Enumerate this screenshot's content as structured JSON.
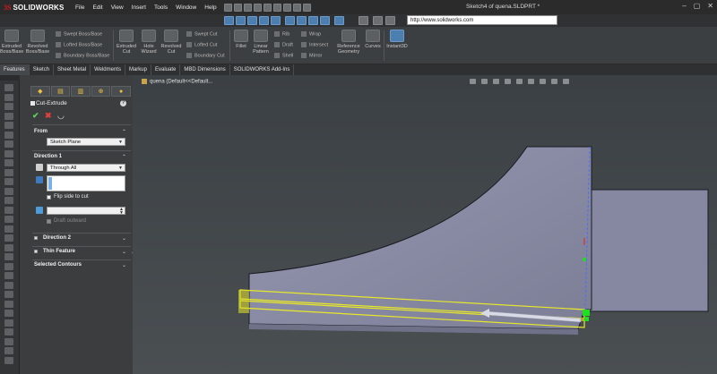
{
  "titlebar": {
    "brand": "SOLIDWORKS",
    "brand_prefix": "3S",
    "menus": [
      "File",
      "Edit",
      "View",
      "Insert",
      "Tools",
      "Window",
      "Help"
    ],
    "doc_title": "Sketch4 of quena.SLDPRT *",
    "window_controls": [
      "–",
      "▢",
      "✕"
    ]
  },
  "url_bar": {
    "value": "http://www.solidworks.com"
  },
  "ribbon": {
    "extruded_boss": "Extruded\nBoss/Base",
    "revolved_boss": "Revolved\nBoss/Base",
    "swept_boss": "Swept Boss/Base",
    "lofted_boss": "Lofted Boss/Base",
    "boundary_boss": "Boundary Boss/Base",
    "extruded_cut": "Extruded\nCut",
    "hole_wizard": "Hole\nWizard",
    "revolved_cut": "Revolved\nCut",
    "swept_cut": "Swept Cut",
    "lofted_cut": "Lofted Cut",
    "boundary_cut": "Boundary Cut",
    "fillet": "Fillet",
    "linear_pattern": "Linear\nPattern",
    "rib": "Rib",
    "draft": "Draft",
    "shell": "Shell",
    "wrap": "Wrap",
    "intersect": "Intersect",
    "mirror": "Mirror",
    "reference_geometry": "Reference\nGeometry",
    "curves": "Curves",
    "instant3d": "Instant3D"
  },
  "tabs": [
    "Features",
    "Sketch",
    "Sheet Metal",
    "Weldments",
    "Markup",
    "Evaluate",
    "MBD Dimensions",
    "SOLIDWORKS Add-Ins"
  ],
  "active_tab": "Features",
  "property_manager": {
    "feature_name": "Cut-Extrude",
    "help": "?",
    "from": {
      "label": "From",
      "value": "Sketch Plane"
    },
    "direction1": {
      "label": "Direction 1",
      "end_condition": "Through All",
      "flip_side_to_cut": "Flip side to cut",
      "draft_outward": "Draft outward"
    },
    "direction2": {
      "label": "Direction 2"
    },
    "thin_feature": {
      "label": "Thin Feature"
    },
    "selected_contours": {
      "label": "Selected Contours"
    }
  },
  "viewport": {
    "tree_root": "quena  (Default<<Default...",
    "colors": {
      "background_top": "#3d4245",
      "face": "#8d8fa8",
      "face_dark": "#6f7188",
      "edge": "#1a1a22",
      "preview_yellow": "#e8e82a",
      "triad_green": "#1ee01e"
    }
  },
  "colors": {
    "accent": "#4c7fb0",
    "ok_green": "#5bd35b",
    "cancel_red": "#e04040",
    "brand_red": "#d71920"
  }
}
